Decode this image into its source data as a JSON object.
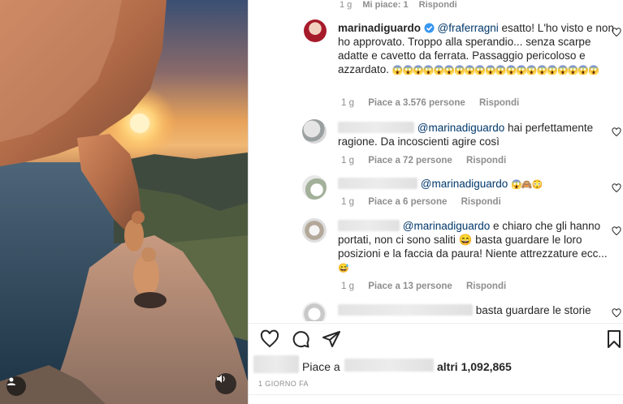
{
  "top_meta": {
    "time": "1 g",
    "likes": "Mi piace: 1",
    "reply": "Rispondi"
  },
  "comments": [
    {
      "user": "marinadiguardo",
      "mention": "@fraferragni",
      "text": " esatto! L'ho visto e non ho approvato. Troppo alla sperandio... senza scarpe adatte e cavetto da ferrata. Passaggio pericoloso e azzardato. ",
      "emoji": "😱😱😱😱😱😱😱😱😱😱😱😱😱😱😱😱😱😱😱😱",
      "time": "1 g",
      "likes": "Piace a 3.576 persone",
      "reply": "Rispondi"
    },
    {
      "mention": "@marinadiguardo",
      "text": " hai perfettamente ragione. Da incoscienti agire così",
      "time": "1 g",
      "likes": "Piace a 72 persone",
      "reply": "Rispondi"
    },
    {
      "mention": "@marinadiguardo",
      "text": " ",
      "emoji": "😱🙈😳",
      "time": "1 g",
      "likes": "Piace a 6 persone",
      "reply": "Rispondi"
    },
    {
      "mention": "@marinadiguardo",
      "text": " e chiaro che gli hanno portati, non ci sono saliti 😄 basta guardare le loro posizioni e la faccia da paura! Niente attrezzature ecc... ",
      "emoji": "😅",
      "time": "1 g",
      "likes": "Piace a 13 persone",
      "reply": "Rispondi"
    },
    {
      "text": "basta guardare le storie"
    }
  ],
  "likes_bar": {
    "label": "Piace a",
    "count": "altri 1,092,865"
  },
  "date": "1 GIORNO FA",
  "colors": {
    "mention": "#00376b",
    "meta": "#8e8e8e",
    "text": "#262626"
  }
}
